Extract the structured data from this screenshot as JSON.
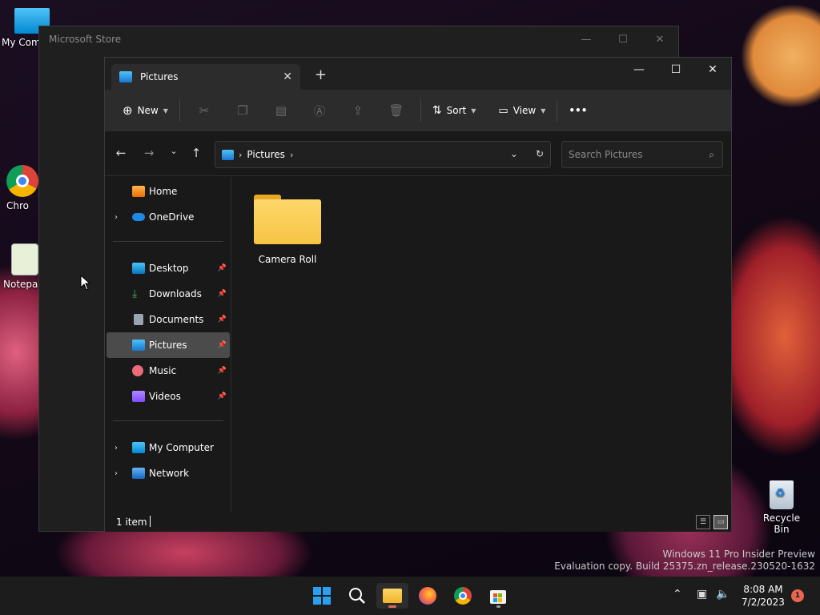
{
  "desktop": {
    "icons": [
      {
        "label": "My Com"
      },
      {
        "label": "Chro"
      },
      {
        "label": "Notepa"
      }
    ],
    "recycle_bin": "Recycle Bin",
    "watermark_line1": "Windows 11 Pro Insider Preview",
    "watermark_line2": "Evaluation copy. Build 25375.zn_release.230520-1632"
  },
  "store_window": {
    "title": "Microsoft Store"
  },
  "explorer": {
    "tab_label": "Pictures",
    "toolbar": {
      "new_label": "New",
      "sort_label": "Sort",
      "view_label": "View",
      "more_label": "•••"
    },
    "address": {
      "segment": "Pictures"
    },
    "search": {
      "placeholder": "Search Pictures"
    },
    "nav": {
      "home": "Home",
      "onedrive": "OneDrive",
      "quick": [
        {
          "label": "Desktop"
        },
        {
          "label": "Downloads"
        },
        {
          "label": "Documents"
        },
        {
          "label": "Pictures"
        },
        {
          "label": "Music"
        },
        {
          "label": "Videos"
        }
      ],
      "my_computer": "My Computer",
      "network": "Network"
    },
    "content": {
      "items": [
        {
          "label": "Camera Roll"
        }
      ]
    },
    "status": {
      "count": "1 item"
    }
  },
  "taskbar": {
    "time": "8:08 AM",
    "date": "7/2/2023",
    "notifications": "1"
  },
  "colors": {
    "accent": "#0078d4",
    "folder": "#f6c444",
    "selected_bg": "#4b4b4b"
  }
}
